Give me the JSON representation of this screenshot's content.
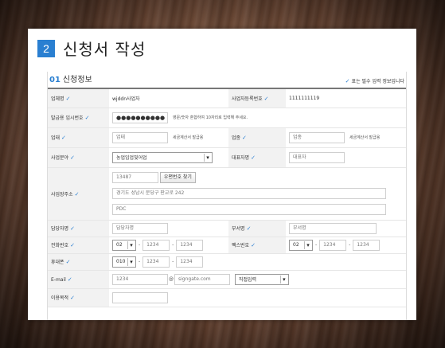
{
  "step": {
    "number": "2",
    "title": "신청서 작성"
  },
  "section": {
    "number": "01",
    "title": "신청정보",
    "required_note": "표는 필수 입력 정보입니다"
  },
  "fields": {
    "company_name": {
      "label": "업체명",
      "value": "wjddn사업자"
    },
    "biz_reg_no": {
      "label": "사업자등록번호",
      "value": "1111111119"
    },
    "temp_password": {
      "label": "발급용 임시번호",
      "value": "●●●●●●●●●●",
      "note": "영문/숫자 혼합하여 10자리로 입력해 주세요."
    },
    "biz_type": {
      "label": "업태",
      "value": "업태",
      "note": "세금계산서 발급용"
    },
    "biz_item": {
      "label": "업종",
      "value": "업종",
      "note": "세금계산서 발급용"
    },
    "biz_field": {
      "label": "사업분야",
      "selected": "농업임업및어업"
    },
    "ceo_name": {
      "label": "대표자명",
      "value": "대표자"
    },
    "address": {
      "label": "사업장주소",
      "zip": "13487",
      "zip_button": "우편번호 찾기",
      "line1": "경기도 성남시 분당구 판교로 242",
      "line2": "PDC"
    },
    "manager_name": {
      "label": "담당자명",
      "value": "담당자명"
    },
    "department": {
      "label": "부서명",
      "value": "부서명"
    },
    "phone": {
      "label": "전화번호",
      "area": "02",
      "mid": "1234",
      "last": "1234"
    },
    "fax": {
      "label": "팩스번호",
      "area": "02",
      "mid": "1234",
      "last": "1234"
    },
    "mobile": {
      "label": "휴대폰",
      "prefix": "010",
      "mid": "1234",
      "last": "1234"
    },
    "email": {
      "label": "E-mail",
      "id": "1234",
      "domain": "signgate.com",
      "domain_select": "직접입력"
    },
    "purpose": {
      "label": "이용목적",
      "value": ""
    }
  },
  "colors": {
    "accent": "#2a7fd1"
  },
  "icons": {
    "check": "check-icon",
    "dropdown": "chevron-down-icon"
  }
}
